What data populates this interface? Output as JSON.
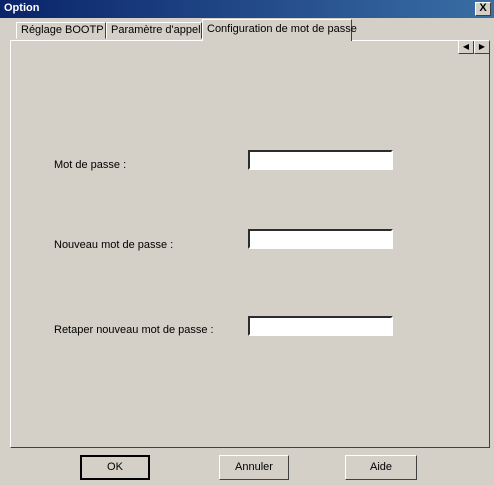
{
  "window": {
    "title": "Option",
    "close_label": "X"
  },
  "tabs": [
    {
      "label": "Réglage BOOTP"
    },
    {
      "label": "Paramètre d'appel"
    },
    {
      "label": "Configuration de mot de passe"
    }
  ],
  "scroll": {
    "left": "◀",
    "right": "▶"
  },
  "form": {
    "password_label": "Mot de passe :",
    "password_value": "",
    "new_password_label": "Nouveau mot de passe :",
    "new_password_value": "",
    "retype_label": "Retaper nouveau mot de passe :",
    "retype_value": ""
  },
  "buttons": {
    "ok": "OK",
    "cancel": "Annuler",
    "help": "Aide"
  }
}
